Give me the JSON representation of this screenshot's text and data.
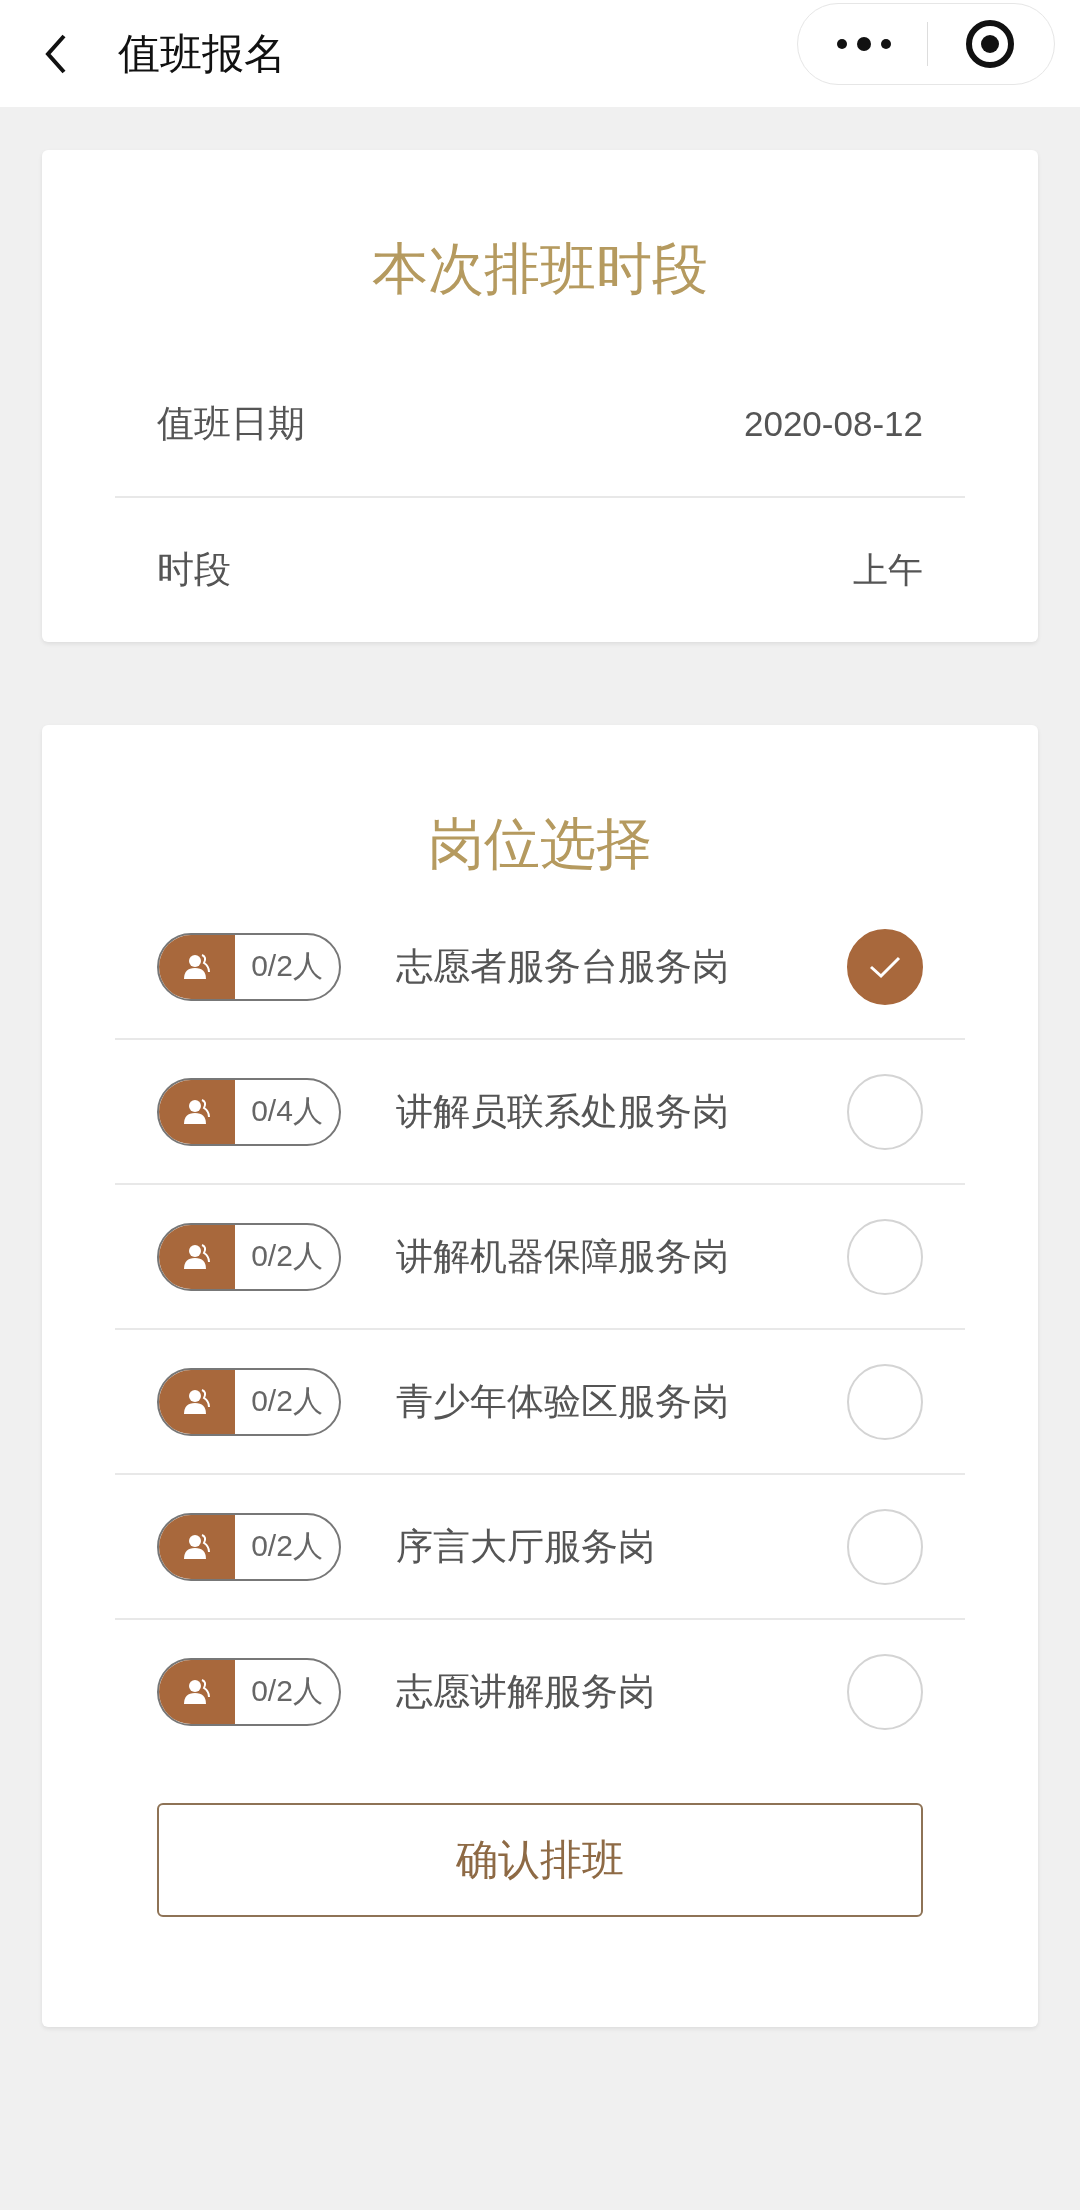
{
  "nav": {
    "title": "值班报名"
  },
  "schedule": {
    "title": "本次排班时段",
    "rows": [
      {
        "label": "值班日期",
        "value": "2020-08-12"
      },
      {
        "label": "时段",
        "value": "上午"
      }
    ]
  },
  "positions": {
    "title": "岗位选择",
    "items": [
      {
        "count": "0/2人",
        "name": "志愿者服务台服务岗",
        "selected": true
      },
      {
        "count": "0/4人",
        "name": "讲解员联系处服务岗",
        "selected": false
      },
      {
        "count": "0/2人",
        "name": "讲解机器保障服务岗",
        "selected": false
      },
      {
        "count": "0/2人",
        "name": "青少年体验区服务岗",
        "selected": false
      },
      {
        "count": "0/2人",
        "name": "序言大厅服务岗",
        "selected": false
      },
      {
        "count": "0/2人",
        "name": "志愿讲解服务岗",
        "selected": false
      }
    ]
  },
  "confirm_button": "确认排班"
}
